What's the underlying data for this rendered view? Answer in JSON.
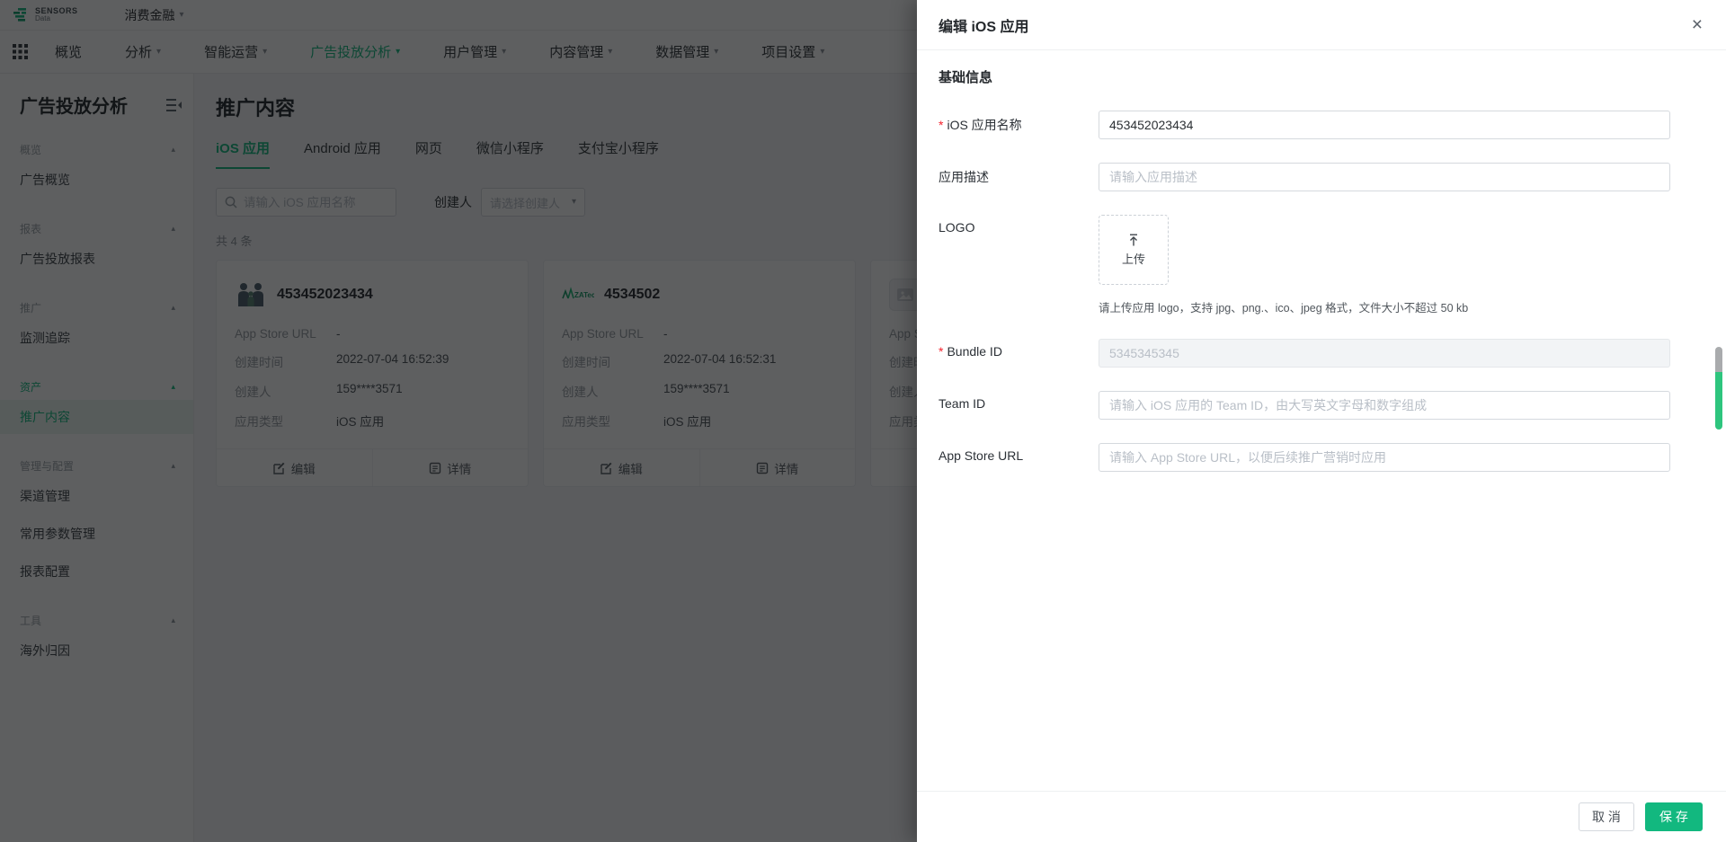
{
  "colors": {
    "accent": "#12b87f",
    "danger": "#f5222d",
    "mask": "rgba(10,12,14,0.66)"
  },
  "icons": {
    "caret_down": "▾",
    "caret_up": "▴",
    "close": "×",
    "dash": "-"
  },
  "topbar": {
    "brand_top": "SENSORS",
    "brand_bottom": "Data",
    "project": "消费金融"
  },
  "nav": {
    "items": [
      {
        "label": "概览"
      },
      {
        "label": "分析"
      },
      {
        "label": "智能运营"
      },
      {
        "label": "广告投放分析"
      },
      {
        "label": "用户管理"
      },
      {
        "label": "内容管理"
      },
      {
        "label": "数据管理"
      },
      {
        "label": "项目设置"
      }
    ]
  },
  "sidebar": {
    "title": "广告投放分析",
    "sections": [
      {
        "header": "概览",
        "items": [
          {
            "label": "广告概览"
          }
        ]
      },
      {
        "header": "报表",
        "items": [
          {
            "label": "广告投放报表"
          }
        ]
      },
      {
        "header": "推广",
        "items": [
          {
            "label": "监测追踪"
          }
        ]
      },
      {
        "header": "资产",
        "items": [
          {
            "label": "推广内容"
          }
        ]
      },
      {
        "header": "管理与配置",
        "items": [
          {
            "label": "渠道管理"
          },
          {
            "label": "常用参数管理"
          },
          {
            "label": "报表配置"
          }
        ]
      },
      {
        "header": "工具",
        "items": [
          {
            "label": "海外归因"
          }
        ]
      }
    ]
  },
  "main": {
    "title": "推广内容",
    "tabs": [
      {
        "label": "iOS 应用"
      },
      {
        "label": "Android 应用"
      },
      {
        "label": "网页"
      },
      {
        "label": "微信小程序"
      },
      {
        "label": "支付宝小程序"
      }
    ],
    "search_placeholder": "请输入 iOS 应用名称",
    "creator_label": "创建人",
    "creator_placeholder": "请选择创建人",
    "count_text": "共 4 条",
    "row_labels": {
      "url": "App Store URL",
      "created_at": "创建时间",
      "creator": "创建人",
      "app_type": "应用类型"
    },
    "actions": {
      "edit": "编辑",
      "detail": "详情"
    },
    "cards": [
      {
        "title": "453452023434",
        "url": "-",
        "created_at": "2022-07-04 16:52:39",
        "creator": "159****3571",
        "app_type": "iOS 应用",
        "logo": "family-icon"
      },
      {
        "title": "4534502",
        "url": "-",
        "created_at": "2022-07-04 16:52:31",
        "creator": "159****3571",
        "app_type": "iOS 应用",
        "logo": "za-tech-logo"
      },
      {
        "title": "",
        "url": "",
        "created_at": "",
        "creator": "",
        "app_type": "",
        "logo": "image-placeholder-icon"
      }
    ]
  },
  "drawer": {
    "title": "编辑 iOS 应用",
    "section_title": "基础信息",
    "fields": {
      "app_name": {
        "label": "iOS 应用名称",
        "value": "453452023434"
      },
      "description": {
        "label": "应用描述",
        "placeholder": "请输入应用描述"
      },
      "logo": {
        "label": "LOGO",
        "upload_text": "上传",
        "hint": "请上传应用 logo，支持 jpg、png.、ico、jpeg 格式，文件大小不超过 50 kb"
      },
      "bundle_id": {
        "label": "Bundle ID",
        "value": "5345345345"
      },
      "team_id": {
        "label": "Team ID",
        "placeholder": "请输入 iOS 应用的 Team ID，由大写英文字母和数字组成"
      },
      "app_store_url": {
        "label": "App Store URL",
        "placeholder": "请输入 App Store URL，以便后续推广营销时应用"
      }
    },
    "footer": {
      "cancel": "取 消",
      "save": "保 存"
    }
  }
}
